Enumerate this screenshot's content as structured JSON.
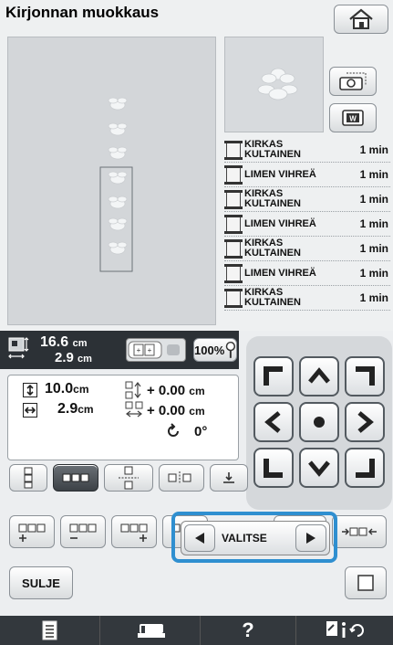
{
  "title": "Kirjonnan muokkaus",
  "threads": [
    {
      "name": "KIRKAS KULTAINEN",
      "time": "1 min"
    },
    {
      "name": "LIMEN VIHREÄ",
      "time": "1 min"
    },
    {
      "name": "KIRKAS KULTAINEN",
      "time": "1 min"
    },
    {
      "name": "LIMEN VIHREÄ",
      "time": "1 min"
    },
    {
      "name": "KIRKAS KULTAINEN",
      "time": "1 min"
    },
    {
      "name": "LIMEN VIHREÄ",
      "time": "1 min"
    },
    {
      "name": "KIRKAS KULTAINEN",
      "time": "1 min"
    }
  ],
  "size": {
    "height_value": "16.6",
    "height_unit": "cm",
    "width_value": "2.9",
    "width_unit": "cm",
    "zoom": "100%"
  },
  "layout": {
    "height_value": "10.0",
    "height_unit": "cm",
    "width_value": "2.9",
    "width_unit": "cm",
    "offset_v": "+ 0.00",
    "offset_v_unit": "cm",
    "offset_h": "+ 0.00",
    "offset_h_unit": "cm",
    "rotation": "0°"
  },
  "buttons": {
    "close": "SULJE",
    "select": "VALITSE"
  },
  "colors": {
    "highlight": "#2f8fd0",
    "background": "#eef0f1",
    "dark_bar": "#2c3136"
  }
}
